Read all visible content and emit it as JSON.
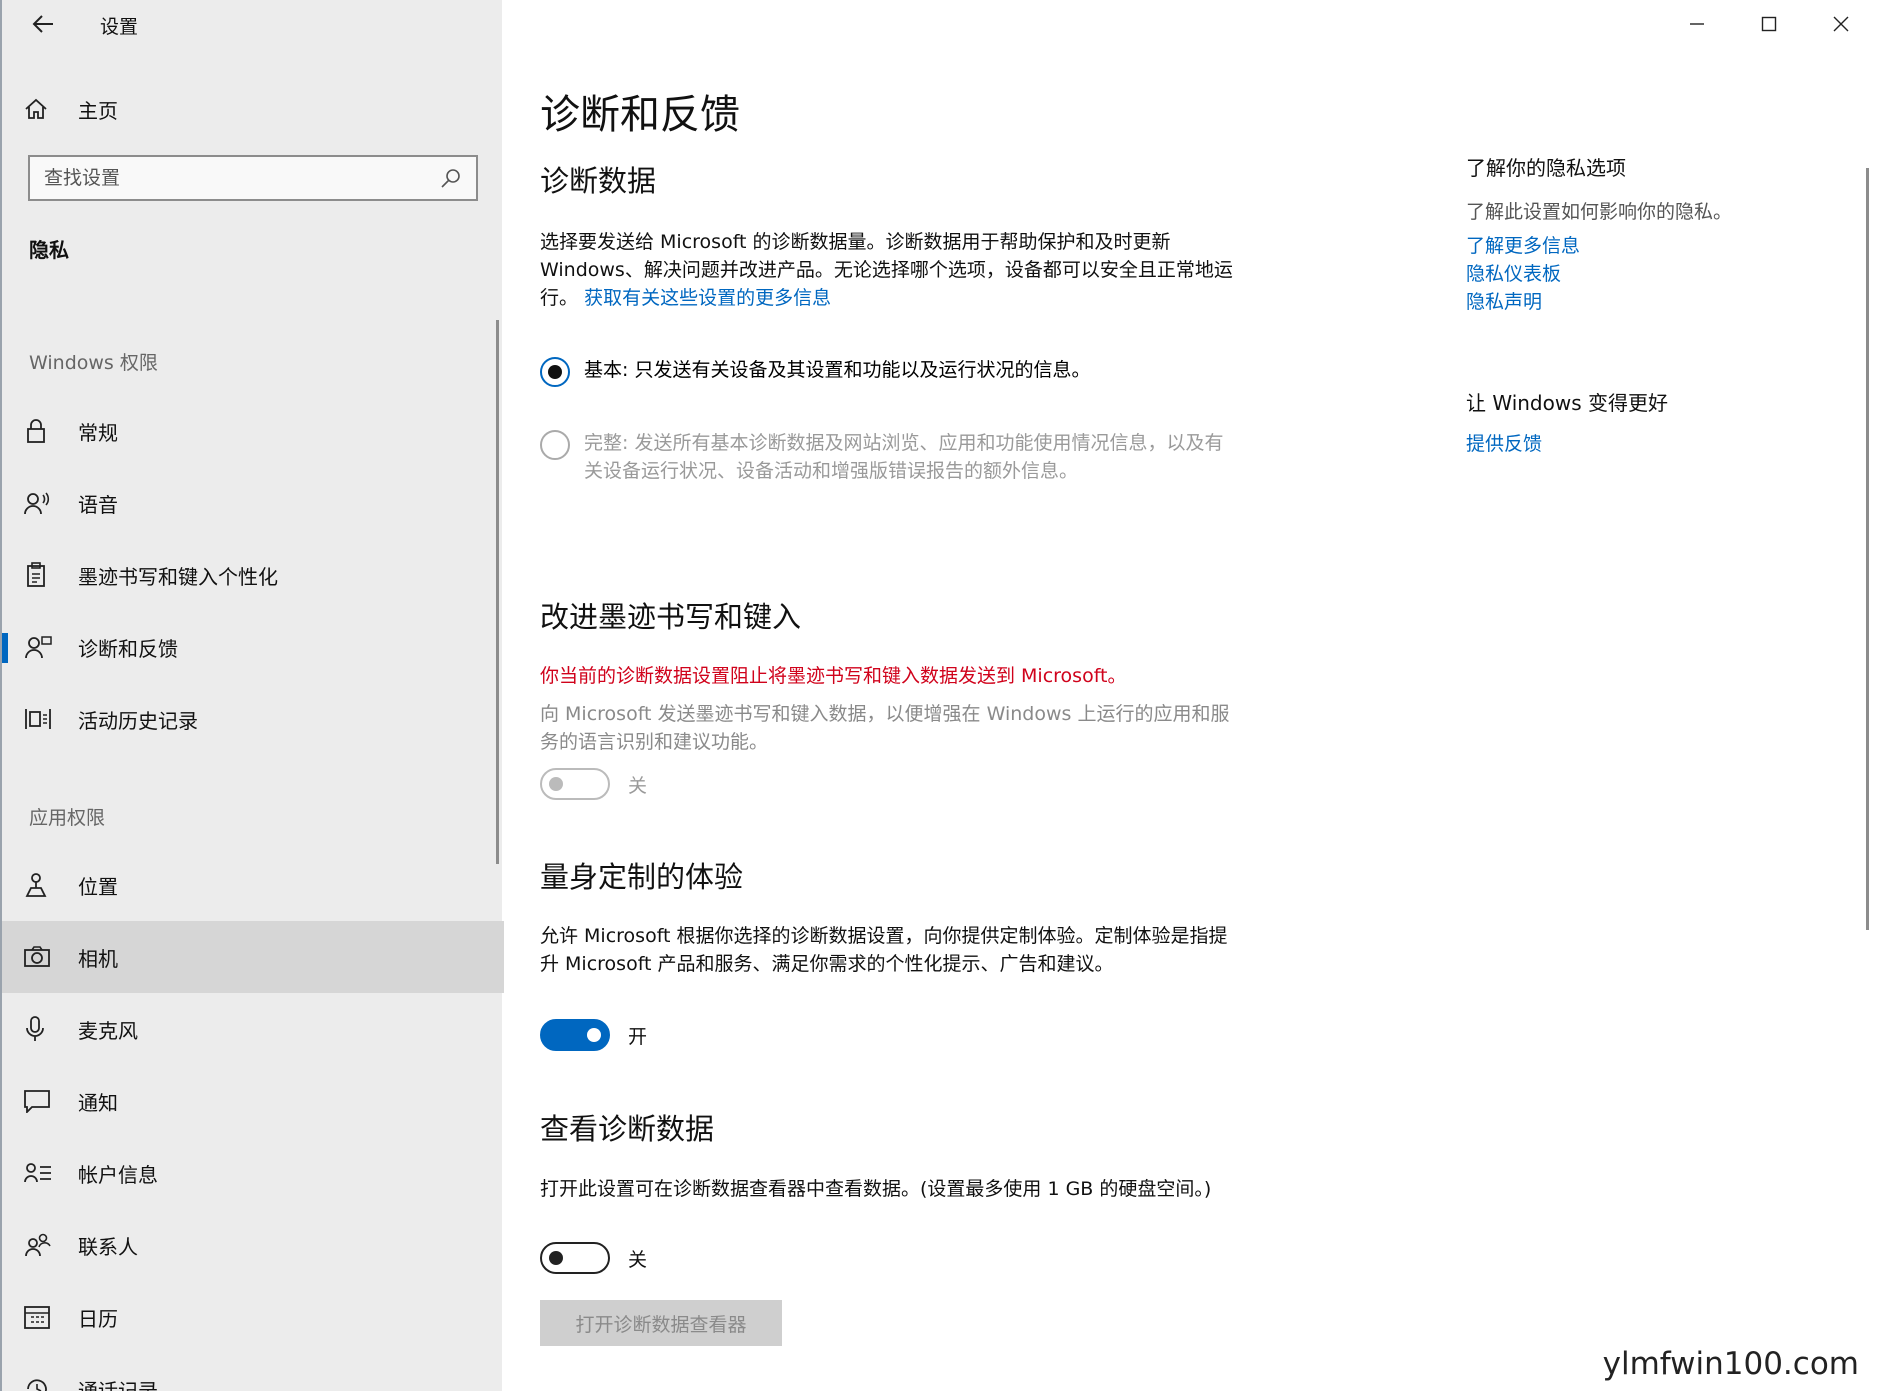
{
  "app": {
    "title": "设置"
  },
  "sidebar": {
    "home_label": "主页",
    "search_placeholder": "查找设置",
    "section_title": "隐私",
    "group_windows": "Windows 权限",
    "windows_items": [
      {
        "label": "常规",
        "icon": "lock-icon"
      },
      {
        "label": "语音",
        "icon": "speech-icon"
      },
      {
        "label": "墨迹书写和键入个性化",
        "icon": "clipboard-icon"
      },
      {
        "label": "诊断和反馈",
        "icon": "feedback-person-icon"
      },
      {
        "label": "活动历史记录",
        "icon": "activity-history-icon"
      }
    ],
    "group_apps": "应用权限",
    "app_items": [
      {
        "label": "位置",
        "icon": "location-icon"
      },
      {
        "label": "相机",
        "icon": "camera-icon"
      },
      {
        "label": "麦克风",
        "icon": "microphone-icon"
      },
      {
        "label": "通知",
        "icon": "notification-icon"
      },
      {
        "label": "帐户信息",
        "icon": "account-info-icon"
      },
      {
        "label": "联系人",
        "icon": "contacts-icon"
      },
      {
        "label": "日历",
        "icon": "calendar-icon"
      },
      {
        "label": "通话记录",
        "icon": "call-history-icon"
      }
    ]
  },
  "main": {
    "page_title": "诊断和反馈",
    "diag": {
      "heading": "诊断数据",
      "description": "选择要发送给 Microsoft 的诊断数据量。诊断数据用于帮助保护和及时更新 Windows、解决问题并改进产品。无论选择哪个选项，设备都可以安全且正常地运行。",
      "more_link": "获取有关这些设置的更多信息",
      "option_basic": "基本: 只发送有关设备及其设置和功能以及运行状况的信息。",
      "option_full": "完整: 发送所有基本诊断数据及网站浏览、应用和功能使用情况信息，以及有关设备运行状况、设备活动和增强版错误报告的额外信息。"
    },
    "ink": {
      "heading": "改进墨迹书写和键入",
      "warning": "你当前的诊断数据设置阻止将墨迹书写和键入数据发送到 Microsoft。",
      "description": "向 Microsoft 发送墨迹书写和键入数据，以便增强在 Windows 上运行的应用和服务的语言识别和建议功能。",
      "toggle_label": "关"
    },
    "tailored": {
      "heading": "量身定制的体验",
      "description": "允许 Microsoft 根据你选择的诊断数据设置，向你提供定制体验。定制体验是指提升 Microsoft 产品和服务、满足你需求的个性化提示、广告和建议。",
      "toggle_label": "开"
    },
    "view": {
      "heading": "查看诊断数据",
      "description": "打开此设置可在诊断数据查看器中查看数据。(设置最多使用 1 GB 的硬盘空间。)",
      "toggle_label": "关",
      "button_label": "打开诊断数据查看器"
    }
  },
  "aside": {
    "privacy_heading": "了解你的隐私选项",
    "privacy_text": "了解此设置如何影响你的隐私。",
    "links": [
      "了解更多信息",
      "隐私仪表板",
      "隐私声明"
    ],
    "better_heading": "让 Windows 变得更好",
    "feedback_link": "提供反馈"
  },
  "watermark": "ylmfwin100.com",
  "colors": {
    "accent": "#0067c0",
    "warning": "#d0021b",
    "sidebar_bg": "#ececec"
  }
}
